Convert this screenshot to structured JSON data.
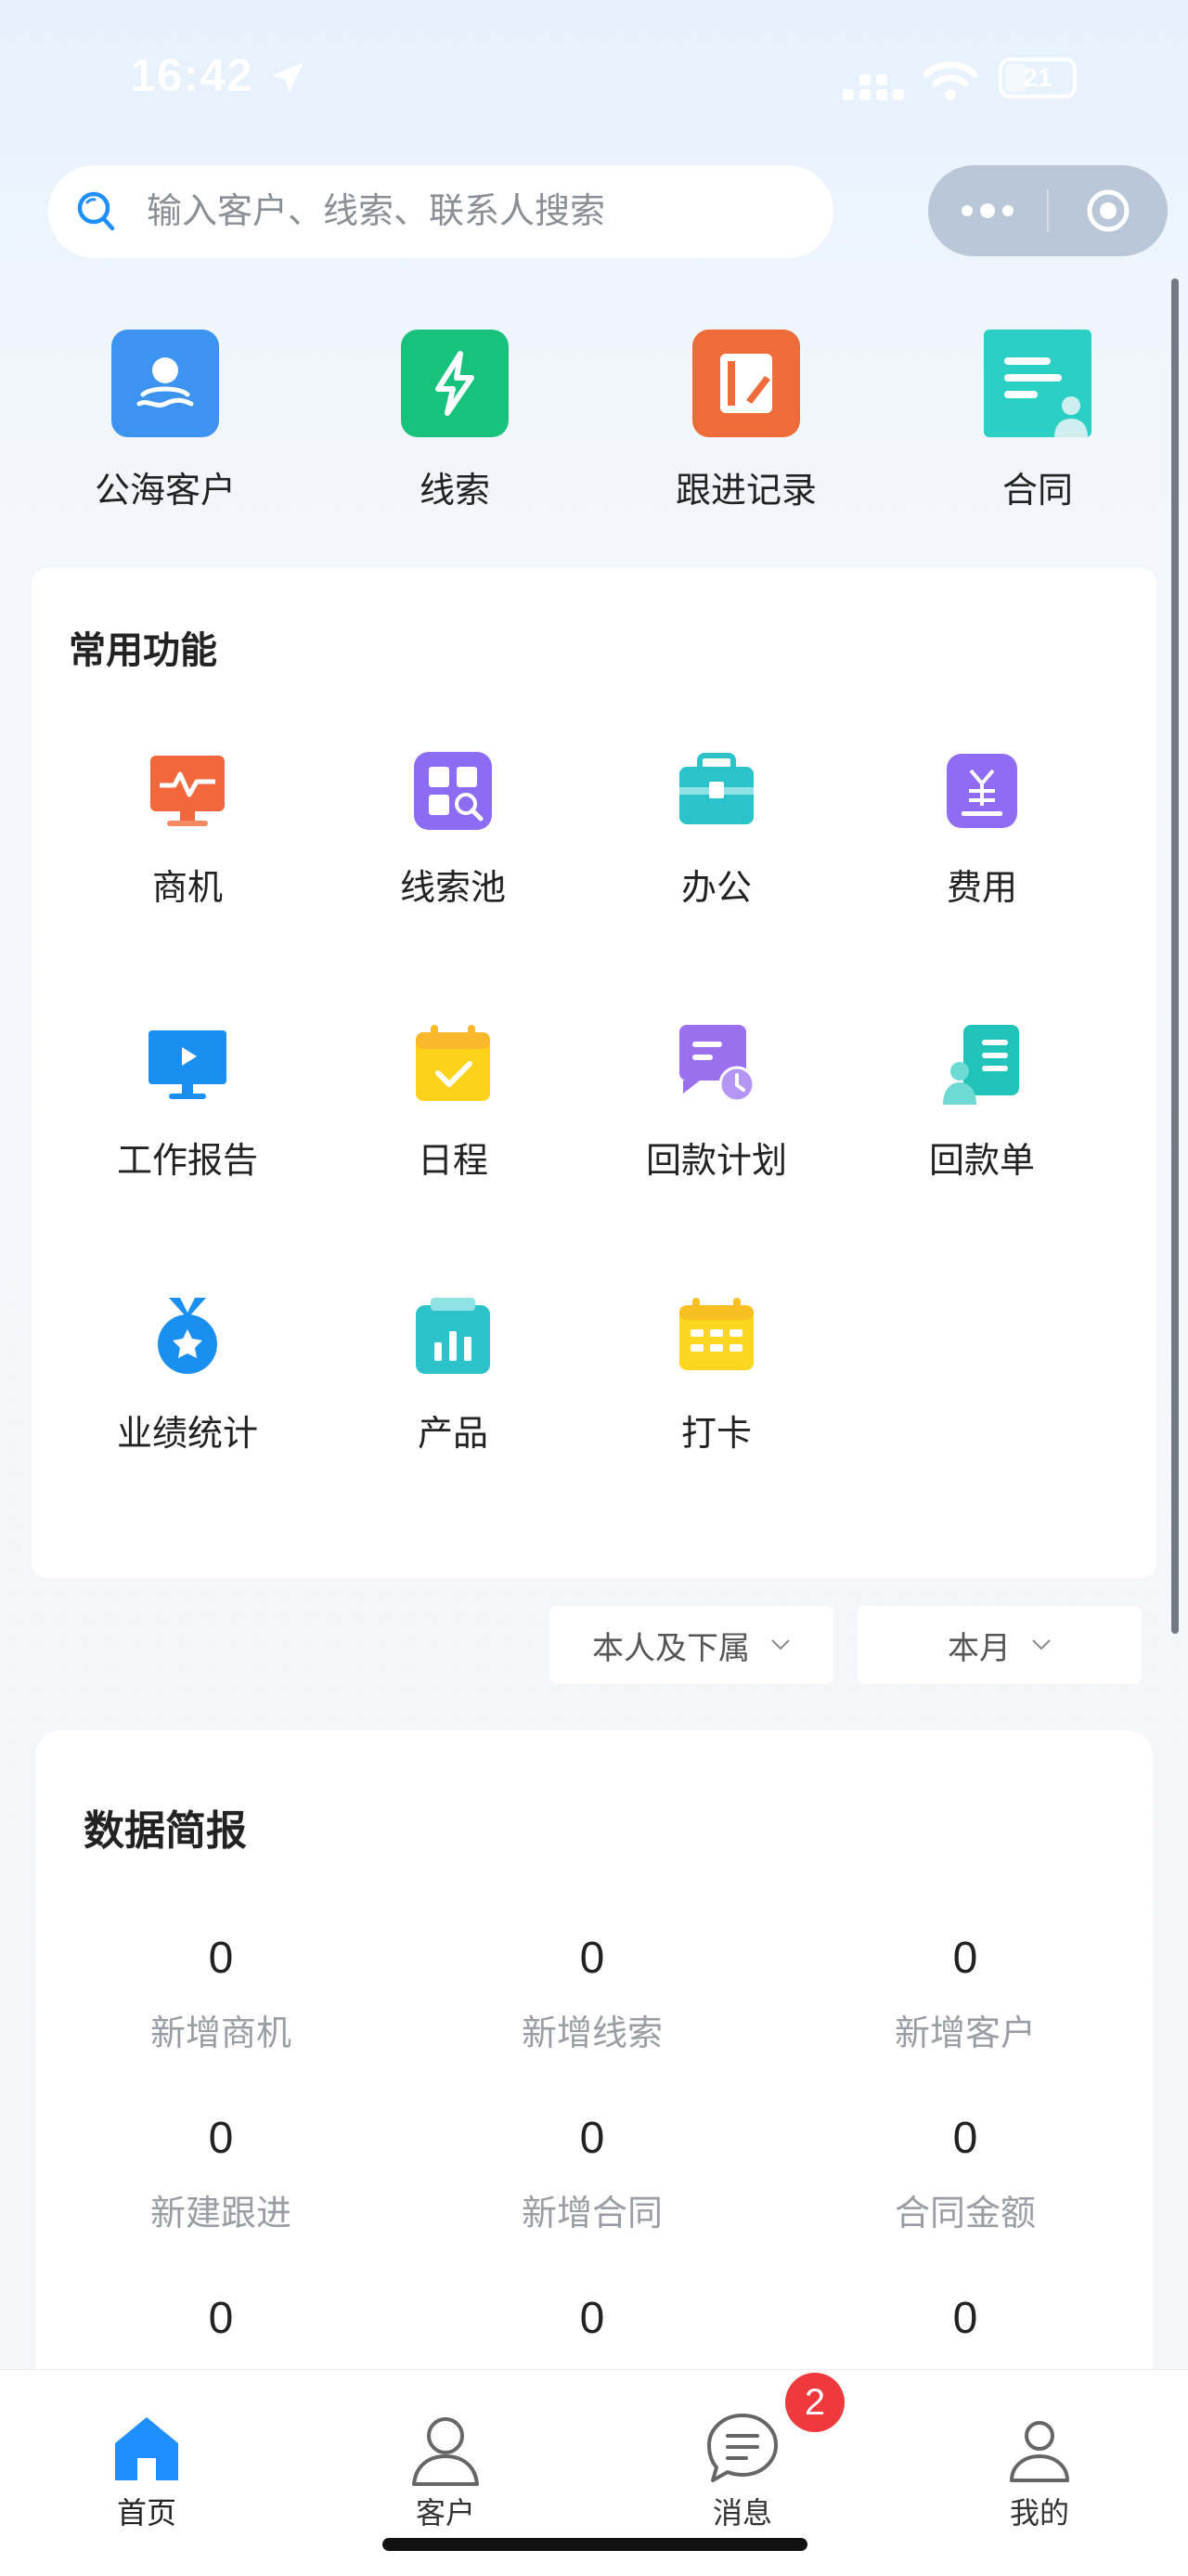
{
  "status_bar": {
    "time": "16:42",
    "battery": "21"
  },
  "search": {
    "placeholder": "输入客户、线索、联系人搜索"
  },
  "quick_access": [
    {
      "label": "公海客户",
      "icon": "public-customer-icon",
      "color": "#3c93f0"
    },
    {
      "label": "线索",
      "icon": "lightning-icon",
      "color": "#19c27c"
    },
    {
      "label": "跟进记录",
      "icon": "notebook-icon",
      "color": "#f06b3a"
    },
    {
      "label": "合同",
      "icon": "contract-icon",
      "color": "#2ad0c4"
    }
  ],
  "common": {
    "title": "常用功能",
    "items": [
      {
        "label": "商机",
        "icon": "business-chance-icon"
      },
      {
        "label": "线索池",
        "icon": "lead-pool-icon"
      },
      {
        "label": "办公",
        "icon": "briefcase-icon"
      },
      {
        "label": "费用",
        "icon": "expense-icon"
      },
      {
        "label": "工作报告",
        "icon": "work-report-icon"
      },
      {
        "label": "日程",
        "icon": "schedule-icon"
      },
      {
        "label": "回款计划",
        "icon": "payment-plan-icon"
      },
      {
        "label": "回款单",
        "icon": "payment-receipt-icon"
      },
      {
        "label": "业绩统计",
        "icon": "medal-icon"
      },
      {
        "label": "产品",
        "icon": "product-icon"
      },
      {
        "label": "打卡",
        "icon": "check-in-icon"
      }
    ]
  },
  "filters": {
    "scope": "本人及下属",
    "period": "本月"
  },
  "report": {
    "title": "数据简报",
    "stats": [
      {
        "value": "0",
        "label": "新增商机"
      },
      {
        "value": "0",
        "label": "新增线索"
      },
      {
        "value": "0",
        "label": "新增客户"
      },
      {
        "value": "0",
        "label": "新建跟进"
      },
      {
        "value": "0",
        "label": "新增合同"
      },
      {
        "value": "0",
        "label": "合同金额"
      },
      {
        "value": "0",
        "label": ""
      },
      {
        "value": "0",
        "label": ""
      },
      {
        "value": "0",
        "label": ""
      }
    ]
  },
  "tabbar": {
    "items": [
      {
        "label": "首页",
        "icon": "home-icon"
      },
      {
        "label": "客户",
        "icon": "customer-icon"
      },
      {
        "label": "消息",
        "icon": "message-icon"
      },
      {
        "label": "我的",
        "icon": "profile-icon"
      }
    ],
    "message_badge": "2",
    "active_color": "#1f8fff"
  }
}
